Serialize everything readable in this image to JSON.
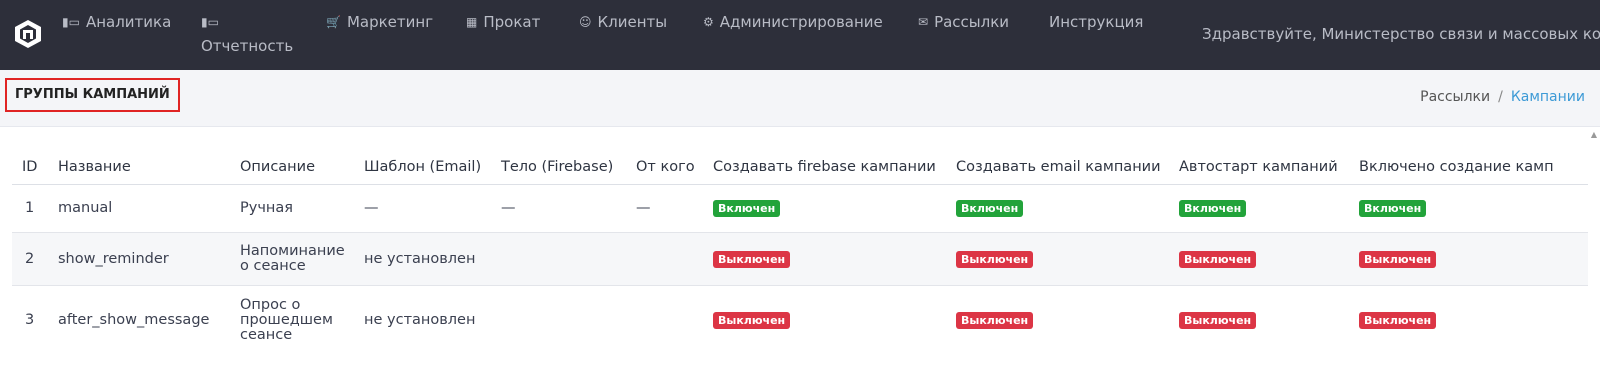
{
  "nav": {
    "items": [
      {
        "icon": "bar-chart-icon",
        "label": "Аналитика"
      },
      {
        "icon": "bar-chart-icon",
        "label": "Отчетность"
      },
      {
        "icon": "cart-icon",
        "label": "Маркетинг"
      },
      {
        "icon": "film-icon",
        "label": "Прокат"
      },
      {
        "icon": "user-icon",
        "label": "Клиенты"
      },
      {
        "icon": "gears-icon",
        "label": "Администрирование"
      },
      {
        "icon": "envelope-icon",
        "label": "Рассылки"
      },
      {
        "icon": "",
        "label": "Инструкция"
      }
    ],
    "greeting": "Здравствуйте, Министерство связи и массовых ком"
  },
  "header": {
    "title": "ГРУППЫ КАМПАНИЙ",
    "breadcrumb": [
      "Рассылки",
      "Кампании"
    ],
    "separator": "/"
  },
  "table": {
    "columns": [
      "ID",
      "Название",
      "Описание",
      "Шаблон (Email)",
      "Тело (Firebase)",
      "От кого",
      "Создавать firebase кампании",
      "Создавать email кампании",
      "Автостарт кампаний",
      "Включено создание камп"
    ],
    "rows": [
      {
        "id": "1",
        "name": "manual",
        "description": "Ручная",
        "template": "—",
        "body": "—",
        "from": "—",
        "firebase": "Включен",
        "email": "Включен",
        "autostart": "Включен",
        "enabled": "Включен"
      },
      {
        "id": "2",
        "name": "show_reminder",
        "description": "Напоминание о сеансе",
        "template": "не установлен",
        "body": "",
        "from": "",
        "firebase": "Выключен",
        "email": "Выключен",
        "autostart": "Выключен",
        "enabled": "Выключен"
      },
      {
        "id": "3",
        "name": "after_show_message",
        "description": "Опрос о прошедшем сеансе",
        "template": "не установлен",
        "body": "",
        "from": "",
        "firebase": "Выключен",
        "email": "Выключен",
        "autostart": "Выключен",
        "enabled": "Выключен"
      }
    ]
  },
  "colors": {
    "navbar": "#2d2f3a",
    "badge_on": "#22a33a",
    "badge_off": "#dc3545",
    "link": "#3d9ad6",
    "title_border": "#e02424"
  }
}
